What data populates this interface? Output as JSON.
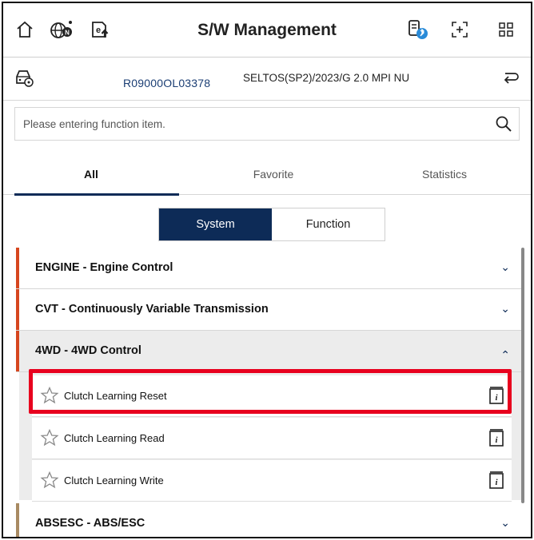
{
  "header": {
    "title": "S/W Management",
    "icons": [
      "home-icon",
      "globe-n-icon",
      "e-upload-icon",
      "bluetooth-vci-icon",
      "screen-capture-icon",
      "grid-menu-icon"
    ]
  },
  "vehicle": {
    "vin": "R09000OL03378",
    "model": "SELTOS(SP2)/2023/G 2.0 MPI NU",
    "icons": [
      "vehicle-settings-icon",
      "back-return-icon"
    ]
  },
  "search": {
    "placeholder": "Please entering function item."
  },
  "tabs": [
    {
      "label": "All",
      "active": true
    },
    {
      "label": "Favorite",
      "active": false
    },
    {
      "label": "Statistics",
      "active": false
    }
  ],
  "segment": {
    "options": [
      {
        "label": "System",
        "active": true
      },
      {
        "label": "Function",
        "active": false
      }
    ]
  },
  "categories": [
    {
      "label": "ENGINE - Engine Control",
      "expanded": false
    },
    {
      "label": "CVT - Continuously Variable Transmission",
      "expanded": false
    },
    {
      "label": "4WD - 4WD Control",
      "expanded": true
    },
    {
      "label": "ABSESC - ABS/ESC",
      "expanded": false
    }
  ],
  "functions": [
    {
      "label": "Clutch Learning Reset",
      "highlighted": true
    },
    {
      "label": "Clutch Learning Read",
      "highlighted": false
    },
    {
      "label": "Clutch Learning Write",
      "highlighted": false
    }
  ],
  "colors": {
    "navy": "#0d2b57",
    "accent_red": "#d6461f",
    "accent_tan": "#a88a62",
    "highlight": "#e8001e"
  }
}
